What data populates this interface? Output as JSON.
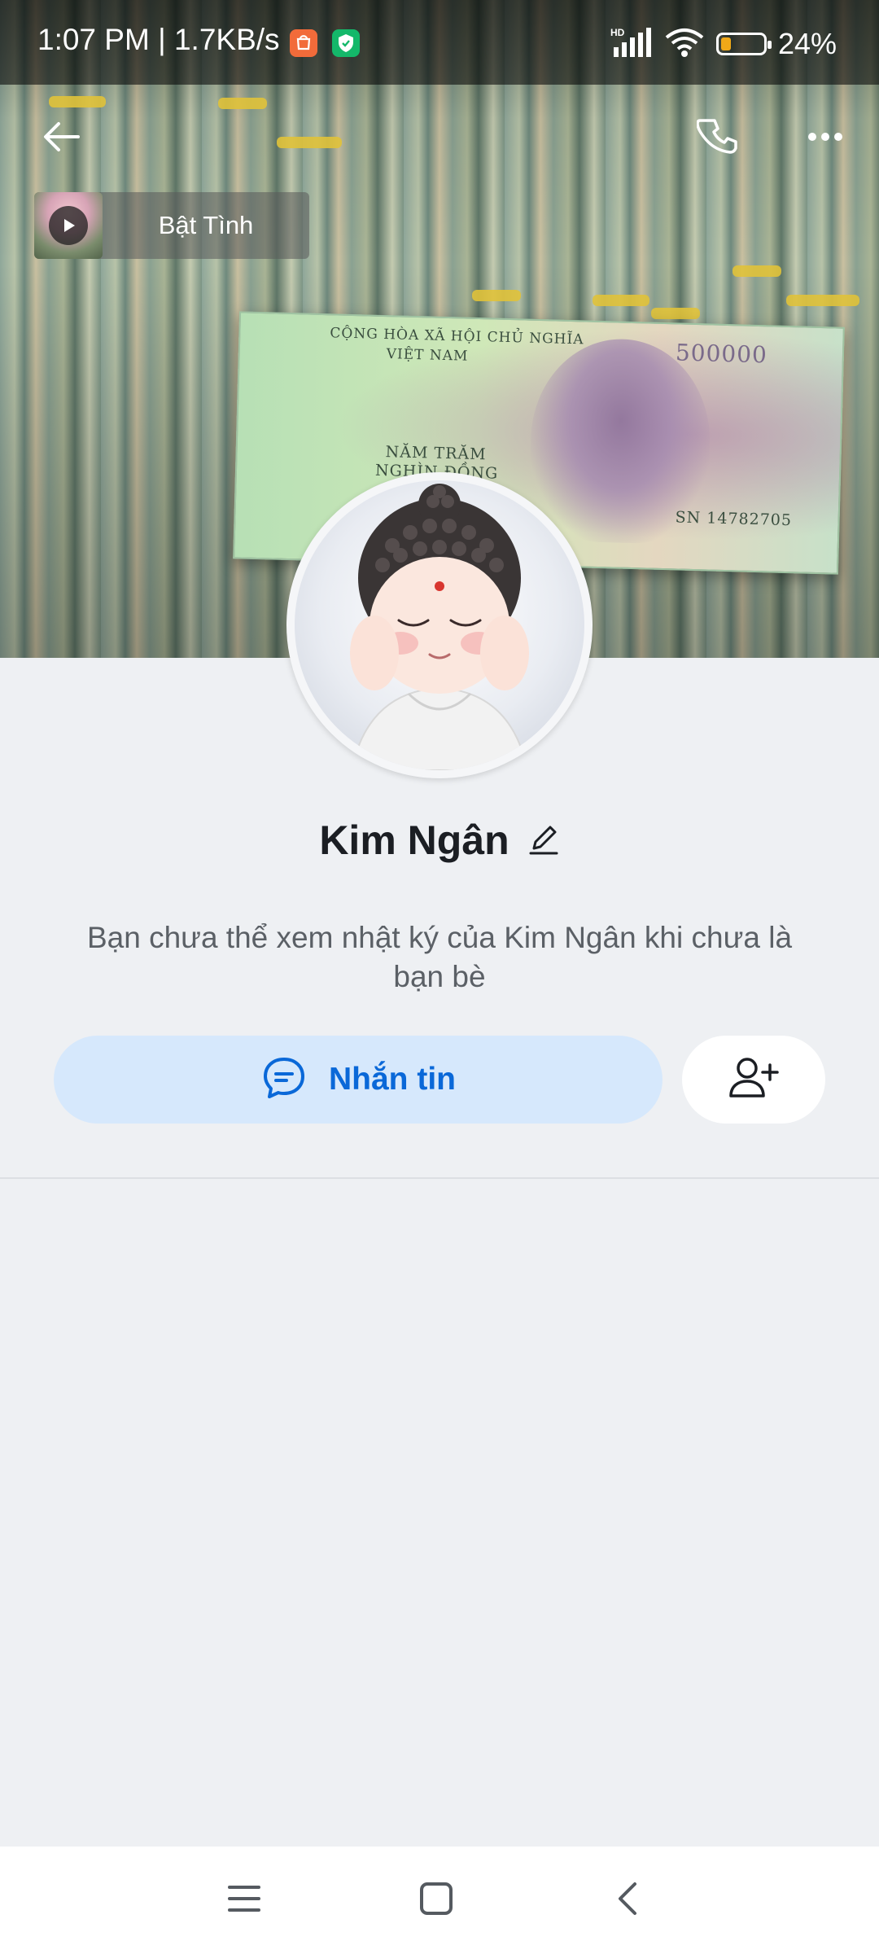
{
  "status_bar": {
    "time": "1:07 PM | 1.7KB/s",
    "battery_percent_text": "24%",
    "battery_level": 0.24,
    "network_label": "HD"
  },
  "cover_image": {
    "banknote": {
      "line1": "CỘNG HÒA XÃ HỘI CHỦ NGHĨA",
      "line2": "VIỆT NAM",
      "line3": "NĂM TRĂM",
      "line4": "NGHÌN ĐỒNG",
      "denomination": "500000",
      "serial": "SN 14782705"
    }
  },
  "profile_music": {
    "title": "Bật Tình"
  },
  "profile": {
    "name": "Kim Ngân",
    "privacy_note": "Bạn chưa thể xem nhật ký của Kim Ngân khi chưa là bạn bè"
  },
  "actions": {
    "message_label": "Nhắn tin"
  },
  "colors": {
    "accent": "#0a68d8",
    "message_button_bg": "#d6e8fc",
    "page_bg": "#eef0f3",
    "battery": "#f0a818"
  },
  "icons": {
    "back": "arrow-left-icon",
    "call": "phone-icon",
    "more": "more-horizontal-icon",
    "play": "play-icon",
    "edit": "pencil-icon",
    "chat": "chat-bubble-icon",
    "add_friend": "add-user-icon",
    "nav_menu": "menu-icon",
    "nav_home": "home-square-icon",
    "nav_back": "chevron-left-icon"
  }
}
